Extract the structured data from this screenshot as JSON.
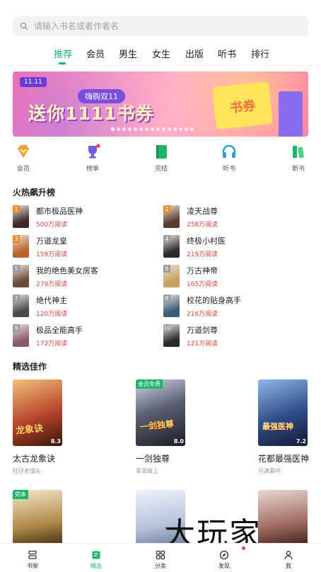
{
  "search": {
    "placeholder": "请输入书名或者作者名"
  },
  "tabs": [
    {
      "label": "推荐",
      "active": true
    },
    {
      "label": "会员"
    },
    {
      "label": "男生"
    },
    {
      "label": "女生"
    },
    {
      "label": "出版"
    },
    {
      "label": "听书"
    },
    {
      "label": "排行"
    }
  ],
  "banner": {
    "badge": "11.11",
    "subtitle": "嗨购双11",
    "headline": "送你1111书券",
    "cart_text": "书券",
    "slide_count": 15,
    "active_slide": 1
  },
  "quick_nav": [
    {
      "label": "会员",
      "icon": "vip-diamond-icon",
      "color": "#ff9c2a"
    },
    {
      "label": "榜单",
      "icon": "trophy-icon",
      "color": "#6c5ce7"
    },
    {
      "label": "完结",
      "icon": "book-complete-icon",
      "color": "#1bb56a"
    },
    {
      "label": "听书",
      "icon": "headphones-icon",
      "color": "#2d9cdb"
    },
    {
      "label": "新书",
      "icon": "new-book-icon",
      "color": "#1bb56a"
    }
  ],
  "hot_section": {
    "title": "火热飙升榜"
  },
  "ranking": [
    {
      "rank": "1",
      "title": "都市极品医神",
      "reads": "500万阅读"
    },
    {
      "rank": "2",
      "title": "凌天战尊",
      "reads": "258万阅读"
    },
    {
      "rank": "3",
      "title": "万道龙皇",
      "reads": "159万阅读"
    },
    {
      "rank": "4",
      "title": "终极小村医",
      "reads": "219万阅读"
    },
    {
      "rank": "5",
      "title": "我的绝色美女房客",
      "reads": "279万阅读"
    },
    {
      "rank": "6",
      "title": "万古神帝",
      "reads": "165万阅读"
    },
    {
      "rank": "7",
      "title": "绝代神主",
      "reads": "120万阅读"
    },
    {
      "rank": "8",
      "title": "校花的贴身高手",
      "reads": "216万阅读"
    },
    {
      "rank": "9",
      "title": "极品全能高手",
      "reads": "172万阅读"
    },
    {
      "rank": "10",
      "title": "万道剑尊",
      "reads": "121万阅读"
    }
  ],
  "featured_section": {
    "title": "精选佳作"
  },
  "featured": [
    {
      "title": "太古龙象诀",
      "author": "旺仔老馒头",
      "score": "8.3",
      "tag": "",
      "cover_text": "龙象诀"
    },
    {
      "title": "一剑独尊",
      "author": "青鸾峰上",
      "score": "8.0",
      "tag": "会员免费",
      "cover_text": "一剑独尊"
    },
    {
      "title": "花都最强医神",
      "author": "月满暮吟",
      "score": "7.2",
      "tag": "",
      "cover_text": "最强医神"
    },
    {
      "tag": "完本"
    },
    {
      "tag": ""
    },
    {
      "tag": ""
    }
  ],
  "watermark": "大玩家",
  "bottom_nav": [
    {
      "label": "书架",
      "icon": "bookshelf-icon"
    },
    {
      "label": "精选",
      "icon": "featured-icon",
      "active": true
    },
    {
      "label": "分类",
      "icon": "category-icon"
    },
    {
      "label": "发现",
      "icon": "discover-icon"
    },
    {
      "label": "我",
      "icon": "profile-icon"
    }
  ],
  "colors": {
    "accent": "#1bb56a",
    "reads": "#e0443c"
  }
}
